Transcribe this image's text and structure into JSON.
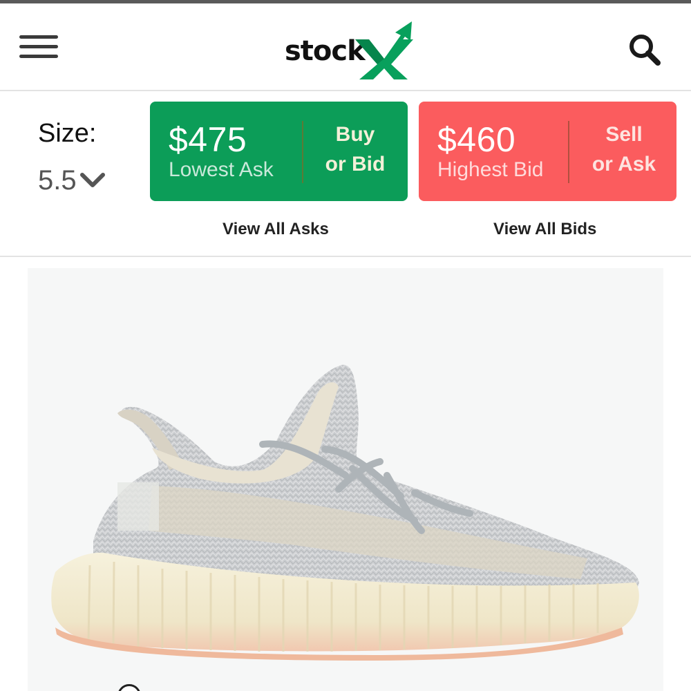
{
  "header": {
    "logo_text": "stock",
    "logo_accent": "X",
    "menu_icon": "hamburger-menu-icon",
    "search_icon": "search-icon"
  },
  "size": {
    "label": "Size:",
    "value": "5.5",
    "chevron_icon": "chevron-down-icon"
  },
  "ask": {
    "price": "$475",
    "label": "Lowest Ask",
    "action_line1": "Buy",
    "action_line2": "or Bid",
    "view_all": "View All Asks"
  },
  "bid": {
    "price": "$460",
    "label": "Highest Bid",
    "action_line1": "Sell",
    "action_line2": "or Ask",
    "view_all": "View All Bids"
  },
  "colors": {
    "brand_green": "#0c9d58",
    "bid_red": "#fb5c5e",
    "logo_green": "#08a05c"
  }
}
